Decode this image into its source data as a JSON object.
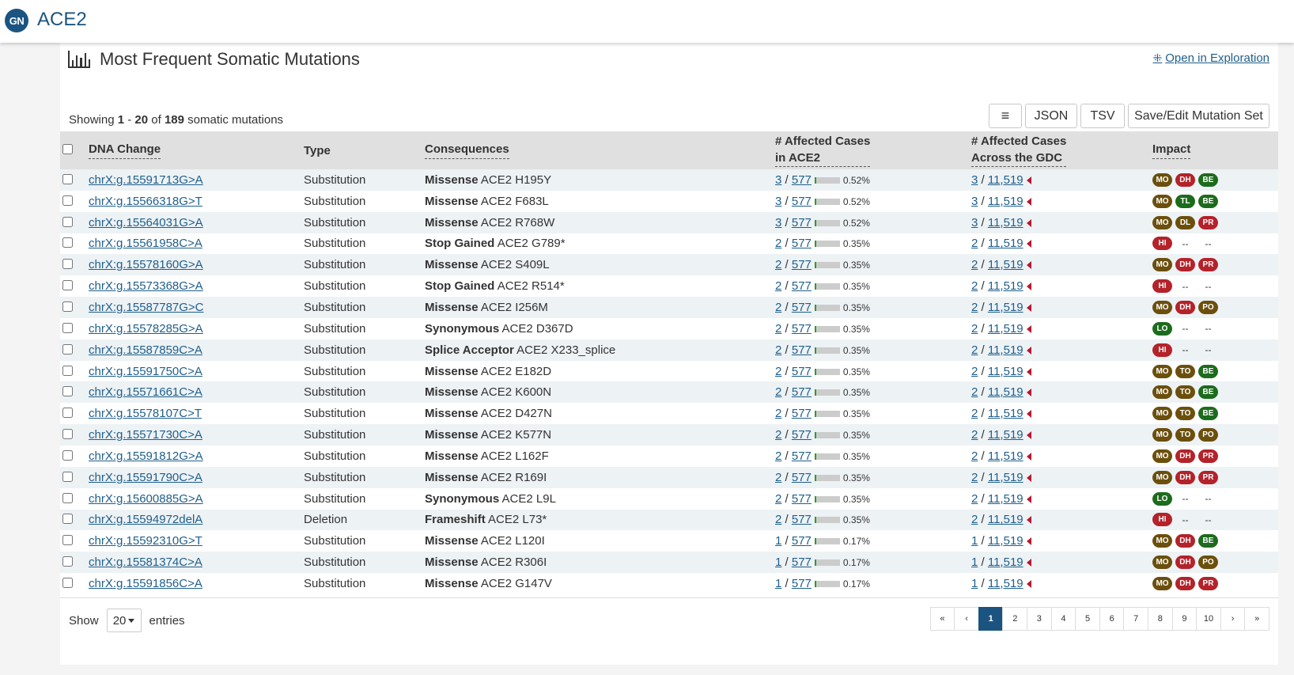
{
  "app": {
    "badge": "GN",
    "gene": "ACE2"
  },
  "section": {
    "title": "Most Frequent Somatic Mutations",
    "explore_link": "Open in Exploration"
  },
  "summary": {
    "prefix": "Showing",
    "start": "1",
    "dash": "-",
    "end": "20",
    "of": "of",
    "total": "189",
    "suffix": "somatic mutations"
  },
  "toolbar": {
    "menu_icon": "≡",
    "json": "JSON",
    "tsv": "TSV",
    "save_edit": "Save/Edit Mutation Set"
  },
  "columns": {
    "dna": "DNA Change",
    "type": "Type",
    "consequences": "Consequences",
    "cases_l1": "# Affected Cases",
    "cases_l2": "in ACE2",
    "gdc_l1": "# Affected Cases",
    "gdc_l2": "Across the GDC",
    "impact": "Impact"
  },
  "colors": {
    "MO": "#6b4f0c",
    "DH": "#b4222a",
    "BE": "#1d6b1d",
    "TL": "#1d6b1d",
    "DL": "#6b4f0c",
    "PR": "#b4222a",
    "HI": "#b4222a",
    "PO": "#6b4f0c",
    "LO": "#1d6b1d",
    "TO": "#6b4f0c"
  },
  "rows": [
    {
      "dna": "chrX:g.15591713G>A",
      "type": "Substitution",
      "cons_type": "Missense",
      "cons_aa": "ACE2 H195Y",
      "cases": "3",
      "cases_total": "577",
      "pct": "0.52%",
      "pct_val": 0.52,
      "gdc": "3",
      "gdc_total": "11,519",
      "impact": [
        "MO",
        "DH",
        "BE"
      ]
    },
    {
      "dna": "chrX:g.15566318G>T",
      "type": "Substitution",
      "cons_type": "Missense",
      "cons_aa": "ACE2 F683L",
      "cases": "3",
      "cases_total": "577",
      "pct": "0.52%",
      "pct_val": 0.52,
      "gdc": "3",
      "gdc_total": "11,519",
      "impact": [
        "MO",
        "TL",
        "BE"
      ]
    },
    {
      "dna": "chrX:g.15564031G>A",
      "type": "Substitution",
      "cons_type": "Missense",
      "cons_aa": "ACE2 R768W",
      "cases": "3",
      "cases_total": "577",
      "pct": "0.52%",
      "pct_val": 0.52,
      "gdc": "3",
      "gdc_total": "11,519",
      "impact": [
        "MO",
        "DL",
        "PR"
      ]
    },
    {
      "dna": "chrX:g.15561958C>A",
      "type": "Substitution",
      "cons_type": "Stop Gained",
      "cons_aa": "ACE2 G789*",
      "cases": "2",
      "cases_total": "577",
      "pct": "0.35%",
      "pct_val": 0.35,
      "gdc": "2",
      "gdc_total": "11,519",
      "impact": [
        "HI",
        "--",
        "--"
      ]
    },
    {
      "dna": "chrX:g.15578160G>A",
      "type": "Substitution",
      "cons_type": "Missense",
      "cons_aa": "ACE2 S409L",
      "cases": "2",
      "cases_total": "577",
      "pct": "0.35%",
      "pct_val": 0.35,
      "gdc": "2",
      "gdc_total": "11,519",
      "impact": [
        "MO",
        "DH",
        "PR"
      ]
    },
    {
      "dna": "chrX:g.15573368G>A",
      "type": "Substitution",
      "cons_type": "Stop Gained",
      "cons_aa": "ACE2 R514*",
      "cases": "2",
      "cases_total": "577",
      "pct": "0.35%",
      "pct_val": 0.35,
      "gdc": "2",
      "gdc_total": "11,519",
      "impact": [
        "HI",
        "--",
        "--"
      ]
    },
    {
      "dna": "chrX:g.15587787G>C",
      "type": "Substitution",
      "cons_type": "Missense",
      "cons_aa": "ACE2 I256M",
      "cases": "2",
      "cases_total": "577",
      "pct": "0.35%",
      "pct_val": 0.35,
      "gdc": "2",
      "gdc_total": "11,519",
      "impact": [
        "MO",
        "DH",
        "PO"
      ]
    },
    {
      "dna": "chrX:g.15578285G>A",
      "type": "Substitution",
      "cons_type": "Synonymous",
      "cons_aa": "ACE2 D367D",
      "cases": "2",
      "cases_total": "577",
      "pct": "0.35%",
      "pct_val": 0.35,
      "gdc": "2",
      "gdc_total": "11,519",
      "impact": [
        "LO",
        "--",
        "--"
      ]
    },
    {
      "dna": "chrX:g.15587859C>A",
      "type": "Substitution",
      "cons_type": "Splice Acceptor",
      "cons_aa": "ACE2 X233_splice",
      "cases": "2",
      "cases_total": "577",
      "pct": "0.35%",
      "pct_val": 0.35,
      "gdc": "2",
      "gdc_total": "11,519",
      "impact": [
        "HI",
        "--",
        "--"
      ]
    },
    {
      "dna": "chrX:g.15591750C>A",
      "type": "Substitution",
      "cons_type": "Missense",
      "cons_aa": "ACE2 E182D",
      "cases": "2",
      "cases_total": "577",
      "pct": "0.35%",
      "pct_val": 0.35,
      "gdc": "2",
      "gdc_total": "11,519",
      "impact": [
        "MO",
        "TO",
        "BE"
      ]
    },
    {
      "dna": "chrX:g.15571661C>A",
      "type": "Substitution",
      "cons_type": "Missense",
      "cons_aa": "ACE2 K600N",
      "cases": "2",
      "cases_total": "577",
      "pct": "0.35%",
      "pct_val": 0.35,
      "gdc": "2",
      "gdc_total": "11,519",
      "impact": [
        "MO",
        "TO",
        "BE"
      ]
    },
    {
      "dna": "chrX:g.15578107C>T",
      "type": "Substitution",
      "cons_type": "Missense",
      "cons_aa": "ACE2 D427N",
      "cases": "2",
      "cases_total": "577",
      "pct": "0.35%",
      "pct_val": 0.35,
      "gdc": "2",
      "gdc_total": "11,519",
      "impact": [
        "MO",
        "TO",
        "BE"
      ]
    },
    {
      "dna": "chrX:g.15571730C>A",
      "type": "Substitution",
      "cons_type": "Missense",
      "cons_aa": "ACE2 K577N",
      "cases": "2",
      "cases_total": "577",
      "pct": "0.35%",
      "pct_val": 0.35,
      "gdc": "2",
      "gdc_total": "11,519",
      "impact": [
        "MO",
        "TO",
        "PO"
      ]
    },
    {
      "dna": "chrX:g.15591812G>A",
      "type": "Substitution",
      "cons_type": "Missense",
      "cons_aa": "ACE2 L162F",
      "cases": "2",
      "cases_total": "577",
      "pct": "0.35%",
      "pct_val": 0.35,
      "gdc": "2",
      "gdc_total": "11,519",
      "impact": [
        "MO",
        "DH",
        "PR"
      ]
    },
    {
      "dna": "chrX:g.15591790C>A",
      "type": "Substitution",
      "cons_type": "Missense",
      "cons_aa": "ACE2 R169I",
      "cases": "2",
      "cases_total": "577",
      "pct": "0.35%",
      "pct_val": 0.35,
      "gdc": "2",
      "gdc_total": "11,519",
      "impact": [
        "MO",
        "DH",
        "PR"
      ]
    },
    {
      "dna": "chrX:g.15600885G>A",
      "type": "Substitution",
      "cons_type": "Synonymous",
      "cons_aa": "ACE2 L9L",
      "cases": "2",
      "cases_total": "577",
      "pct": "0.35%",
      "pct_val": 0.35,
      "gdc": "2",
      "gdc_total": "11,519",
      "impact": [
        "LO",
        "--",
        "--"
      ]
    },
    {
      "dna": "chrX:g.15594972delA",
      "type": "Deletion",
      "cons_type": "Frameshift",
      "cons_aa": "ACE2 L73*",
      "cases": "2",
      "cases_total": "577",
      "pct": "0.35%",
      "pct_val": 0.35,
      "gdc": "2",
      "gdc_total": "11,519",
      "impact": [
        "HI",
        "--",
        "--"
      ]
    },
    {
      "dna": "chrX:g.15592310G>T",
      "type": "Substitution",
      "cons_type": "Missense",
      "cons_aa": "ACE2 L120I",
      "cases": "1",
      "cases_total": "577",
      "pct": "0.17%",
      "pct_val": 0.17,
      "gdc": "1",
      "gdc_total": "11,519",
      "impact": [
        "MO",
        "DH",
        "BE"
      ]
    },
    {
      "dna": "chrX:g.15581374C>A",
      "type": "Substitution",
      "cons_type": "Missense",
      "cons_aa": "ACE2 R306I",
      "cases": "1",
      "cases_total": "577",
      "pct": "0.17%",
      "pct_val": 0.17,
      "gdc": "1",
      "gdc_total": "11,519",
      "impact": [
        "MO",
        "DH",
        "PO"
      ]
    },
    {
      "dna": "chrX:g.15591856C>A",
      "type": "Substitution",
      "cons_type": "Missense",
      "cons_aa": "ACE2 G147V",
      "cases": "1",
      "cases_total": "577",
      "pct": "0.17%",
      "pct_val": 0.17,
      "gdc": "1",
      "gdc_total": "11,519",
      "impact": [
        "MO",
        "DH",
        "PR"
      ]
    }
  ],
  "footer": {
    "show_label": "Show",
    "page_size": "20",
    "entries_label": "entries",
    "pages": [
      "«",
      "‹",
      "1",
      "2",
      "3",
      "4",
      "5",
      "6",
      "7",
      "8",
      "9",
      "10",
      "›",
      "»"
    ],
    "active_page": "1"
  }
}
